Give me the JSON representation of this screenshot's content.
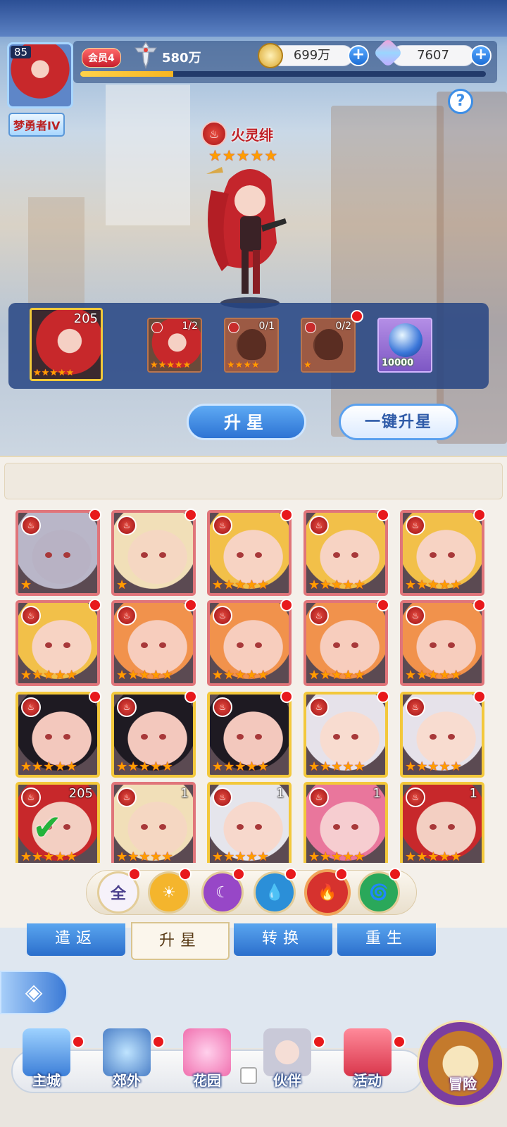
{
  "player": {
    "level": "85",
    "rank": "梦勇者IV",
    "vip": "会员4",
    "power": "580万",
    "xp_fraction": 0.23
  },
  "resources": {
    "gold": "699万",
    "gems": "7607"
  },
  "hero": {
    "name": "火灵绯",
    "stars": 5,
    "element": "fire"
  },
  "upgrade": {
    "main_count": "205",
    "materials": [
      {
        "count": "1/2",
        "stars": 5,
        "type": "portrait"
      },
      {
        "count": "0/1",
        "stars": 4,
        "type": "silhouette"
      },
      {
        "count": "0/2",
        "stars": 1,
        "type": "silhouette"
      }
    ],
    "orb_amount": "10000"
  },
  "buttons": {
    "star_up": "升星",
    "one_click": "一键升星"
  },
  "help_label": "?",
  "grid": {
    "cards": [
      {
        "hair": "#b9b6c8",
        "skin": "#b8b2c4",
        "stars": 1,
        "frame": "red",
        "count": "",
        "dot": true
      },
      {
        "hair": "#f1dfb8",
        "skin": "#f5d7c2",
        "stars": 1,
        "frame": "red",
        "count": "",
        "dot": true
      },
      {
        "hair": "#f2c049",
        "skin": "#f7d3c3",
        "stars": 5,
        "frame": "red",
        "count": "",
        "dot": true
      },
      {
        "hair": "#f2c049",
        "skin": "#f7d3c3",
        "stars": 5,
        "frame": "red",
        "count": "",
        "dot": true
      },
      {
        "hair": "#f2c049",
        "skin": "#f7d3c3",
        "stars": 5,
        "frame": "red",
        "count": "",
        "dot": true
      },
      {
        "hair": "#f2c049",
        "skin": "#f7d3c3",
        "stars": 5,
        "frame": "red",
        "count": "",
        "dot": true
      },
      {
        "hair": "#f1924c",
        "skin": "#f7cdbd",
        "stars": 5,
        "frame": "red",
        "count": "",
        "dot": true
      },
      {
        "hair": "#f1924c",
        "skin": "#f7cdbd",
        "stars": 5,
        "frame": "red",
        "count": "",
        "dot": true
      },
      {
        "hair": "#f1924c",
        "skin": "#f7cdbd",
        "stars": 5,
        "frame": "red",
        "count": "",
        "dot": true
      },
      {
        "hair": "#f1924c",
        "skin": "#f7cdbd",
        "stars": 5,
        "frame": "red",
        "count": "",
        "dot": true
      },
      {
        "hair": "#1e1a22",
        "skin": "#f3c8bd",
        "stars": 5,
        "frame": "gold",
        "count": "",
        "dot": true
      },
      {
        "hair": "#1e1a22",
        "skin": "#f3c8bd",
        "stars": 5,
        "frame": "gold",
        "count": "",
        "dot": true
      },
      {
        "hair": "#1e1a22",
        "skin": "#f3c8bd",
        "stars": 5,
        "frame": "gold",
        "count": "",
        "dot": true
      },
      {
        "hair": "#e6e2ea",
        "skin": "#f8dcd0",
        "stars": 5,
        "frame": "gold",
        "count": "",
        "dot": true
      },
      {
        "hair": "#e6e2ea",
        "skin": "#f8dcd0",
        "stars": 5,
        "frame": "gold",
        "count": "",
        "dot": true
      },
      {
        "hair": "#c7282b",
        "skin": "#f3cfc2",
        "stars": 5,
        "frame": "gold",
        "count": "205",
        "dot": false,
        "selected": true
      },
      {
        "hair": "#f1dfb8",
        "skin": "#f5d7c2",
        "stars": 5,
        "frame": "red",
        "count": "1",
        "dot": false
      },
      {
        "hair": "#e5e5ec",
        "skin": "#f7d8cc",
        "stars": 5,
        "frame": "gold",
        "count": "1",
        "dot": false
      },
      {
        "hair": "#e9769c",
        "skin": "#f6cdd0",
        "stars": 5,
        "frame": "gold",
        "count": "1",
        "dot": false
      },
      {
        "hair": "#c7282b",
        "skin": "#f3cfc2",
        "stars": 5,
        "frame": "gold",
        "count": "1",
        "dot": false
      }
    ]
  },
  "filters": [
    {
      "label": "全",
      "color": "#f6f2fa",
      "text": "#4a3f8c",
      "icon": "all",
      "dot": true
    },
    {
      "label": "☀",
      "color": "#f4b52d",
      "text": "#fff",
      "icon": "light",
      "dot": true
    },
    {
      "label": "☾",
      "color": "#9747c7",
      "text": "#fff",
      "icon": "dark",
      "dot": true
    },
    {
      "label": "💧",
      "color": "#2b8fd8",
      "text": "#fff",
      "icon": "water",
      "dot": true
    },
    {
      "label": "🔥",
      "color": "#d6322e",
      "text": "#fff",
      "icon": "fire",
      "dot": true
    },
    {
      "label": "🌀",
      "color": "#2aa85a",
      "text": "#fff",
      "icon": "wind",
      "dot": true
    }
  ],
  "tabs": [
    "遣返",
    "升星",
    "转换",
    "重生"
  ],
  "active_tab": 1,
  "nav": [
    {
      "label": "主城",
      "icon": "castle",
      "dot": true
    },
    {
      "label": "郊外",
      "icon": "portal",
      "dot": true
    },
    {
      "label": "花园",
      "icon": "heart",
      "dot": false
    },
    {
      "label": "伙伴",
      "icon": "partner",
      "dot": true
    },
    {
      "label": "活动",
      "icon": "gift",
      "dot": true
    }
  ],
  "adventure_label": "冒险"
}
